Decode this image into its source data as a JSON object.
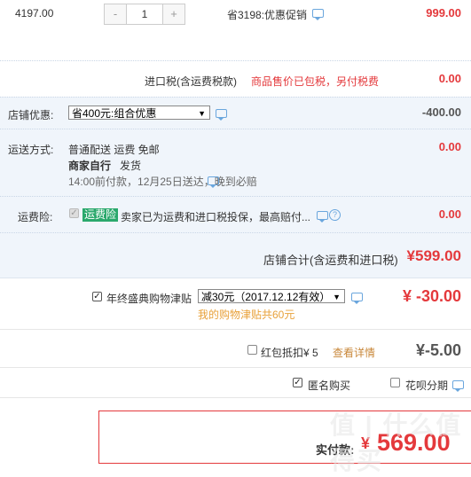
{
  "item": {
    "unit_price": "4197.00",
    "quantity": {
      "minus": "-",
      "value": "1",
      "plus": "+"
    },
    "promo": "省3198:优惠促销",
    "price": "999.00"
  },
  "import_tax": {
    "label": "进口税(含运费税款)",
    "note": "商品售价已包税，另付税费",
    "price": "0.00"
  },
  "store_discount": {
    "label": "店铺优惠:",
    "selected": "省400元:组合优惠",
    "arrow": "▼",
    "price": "-400.00"
  },
  "shipping": {
    "label": "运送方式:",
    "method": "普通配送 运费 免邮",
    "seller": "商家自行",
    "seller_action": "发货",
    "eta": "14:00前付款，12月25日送达，晚到必赔",
    "price": "0.00"
  },
  "insurance": {
    "label": "运费险:",
    "check": "✓",
    "badge": "运费险",
    "text": "卖家已为运费和进口税投保，最高赔付...",
    "help": "?",
    "price": "0.00"
  },
  "store_total": {
    "label": "店铺合计(含运费和进口税)",
    "price": "¥599.00"
  },
  "allowance": {
    "check": "✓",
    "label": "年终盛典购物津贴",
    "selected": "减30元（2017.12.12有效）",
    "arrow": "▼",
    "sub": "我的购物津贴共60元",
    "price": "¥ -30.00"
  },
  "red_packet": {
    "label": "红包抵扣¥ 5",
    "link": "查看详情",
    "price": "¥-5.00"
  },
  "options": {
    "anon_check": "✓",
    "anon_label": "匿名购买",
    "huabei_label": "花呗分期"
  },
  "payment": {
    "label": "实付款:",
    "currency": "¥",
    "amount": "569.00"
  },
  "watermark": "值 | 什么值得买",
  "colors": {
    "accent": "#e4393c",
    "band": "#f0f5fb",
    "link": "#6aa6dd",
    "badge": "#2aa86c"
  }
}
